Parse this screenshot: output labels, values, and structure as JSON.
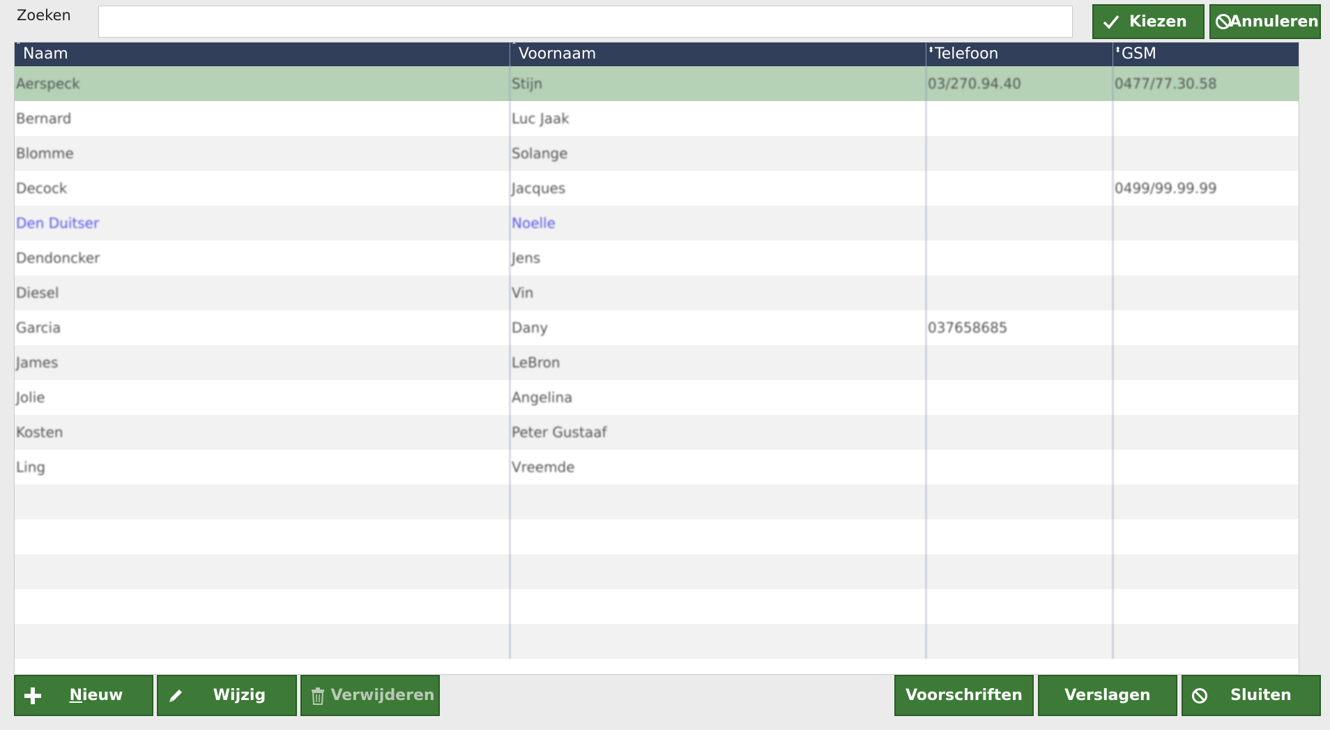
{
  "search": {
    "label": "Zoeken",
    "value": "",
    "placeholder": ""
  },
  "top_buttons": {
    "choose": "Kiezen",
    "cancel": "Annuleren"
  },
  "table": {
    "columns": [
      "Naam",
      "Voornaam",
      "Telefoon",
      "GSM"
    ],
    "rows": [
      [
        "Aerspeck",
        "Stijn",
        "03/270.94.40",
        "0477/77.30.58"
      ],
      [
        "Bernard",
        "Luc Jaak",
        "",
        ""
      ],
      [
        "Blomme",
        "Solange",
        "",
        ""
      ],
      [
        "Decock",
        "Jacques",
        "",
        "0499/99.99.99"
      ],
      [
        "Den Duitser",
        "Noelle",
        "",
        ""
      ],
      [
        "Dendoncker",
        "Jens",
        "",
        ""
      ],
      [
        "Diesel",
        "Vin",
        "",
        ""
      ],
      [
        "Garcia",
        "Dany",
        "037658685",
        ""
      ],
      [
        "James",
        "LeBron",
        "",
        ""
      ],
      [
        "Jolie",
        "Angelina",
        "",
        ""
      ],
      [
        "Kosten",
        "Peter Gustaaf",
        "",
        ""
      ],
      [
        "Ling",
        "Vreemde",
        "",
        ""
      ],
      [
        "",
        "",
        "",
        ""
      ],
      [
        "",
        "",
        "",
        ""
      ],
      [
        "",
        "",
        "",
        ""
      ],
      [
        "",
        "",
        "",
        ""
      ],
      [
        "",
        "",
        "",
        ""
      ]
    ],
    "selected_row": 0,
    "link_row": 4
  },
  "bottom_buttons": {
    "new_rest": "ieuw",
    "new_mnemonic": "N",
    "edit": "Wijzig",
    "delete": "Verwijderen",
    "prescriptions": "Voorschriften",
    "reports": "Verslagen",
    "close": "Sluiten"
  },
  "colors": {
    "accent": "#3d7a37",
    "header": "#323f5a",
    "selected": "#b5d2b7",
    "link": "#5a5bea"
  }
}
